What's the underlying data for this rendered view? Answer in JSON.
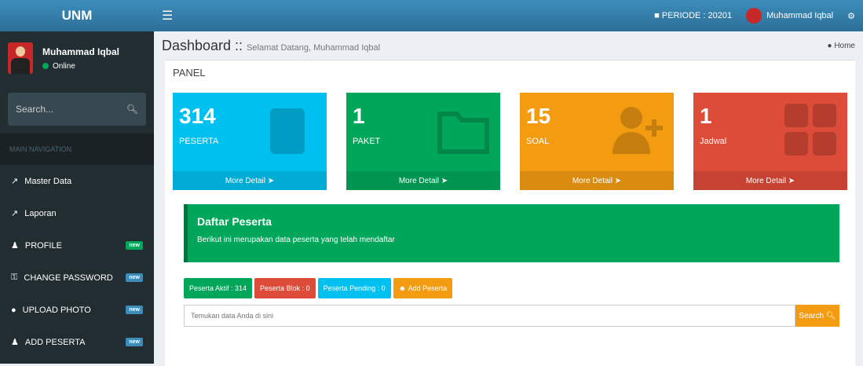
{
  "brand": "UNM",
  "user": {
    "name": "Muhammad Iqbal",
    "status": "Online"
  },
  "sidebar": {
    "search_placeholder": "Search...",
    "nav_header": "MAIN NAVIGATION",
    "items": [
      {
        "label": "Master Data",
        "icon": "share-icon",
        "badge": ""
      },
      {
        "label": "Laporan",
        "icon": "share-icon",
        "badge": ""
      },
      {
        "label": "PROFILE",
        "icon": "user-icon",
        "badge": "new",
        "badge_color": "#00a65a"
      },
      {
        "label": "CHANGE PASSWORD",
        "icon": "key-icon",
        "badge": "new",
        "badge_color": "#3c8dbc"
      },
      {
        "label": "UPLOAD PHOTO",
        "icon": "comment-icon",
        "badge": "new",
        "badge_color": "#3c8dbc"
      },
      {
        "label": "ADD PESERTA",
        "icon": "user-plus-icon",
        "badge": "new",
        "badge_color": "#3c8dbc"
      }
    ]
  },
  "topbar": {
    "periode": "PERIODE : 20201",
    "user": "Muhammad Iqbal"
  },
  "page": {
    "title": "Dashboard ::",
    "subtitle": "Selamat Datang, Muhammad Iqbal",
    "breadcrumb": "Home"
  },
  "panel": {
    "title": "PANEL",
    "cards": [
      {
        "value": "314",
        "label": "PESERTA",
        "more": "More Detail",
        "color": "#00c0ef",
        "icon": "book-icon"
      },
      {
        "value": "1",
        "label": "PAKET",
        "more": "More Detail",
        "color": "#00a65a",
        "icon": "folder-icon"
      },
      {
        "value": "15",
        "label": "SOAL",
        "more": "More Detail",
        "color": "#f39c12",
        "icon": "user-add-icon"
      },
      {
        "value": "1",
        "label": "Jadwal",
        "more": "More Detail",
        "color": "#dd4b39",
        "icon": "grid-icon"
      }
    ]
  },
  "callout": {
    "title": "Daftar Peserta",
    "text": "Berikut ini merupakan data peserta yang telah mendaftar"
  },
  "buttons": {
    "aktif": "Peserta Aktif : 314",
    "blok": "Peserta Blok : 0",
    "pending": "Peserta Pending : 0",
    "add": "Add Peserta"
  },
  "search": {
    "placeholder": "Temukan data Anda di sini",
    "button": "Search"
  }
}
